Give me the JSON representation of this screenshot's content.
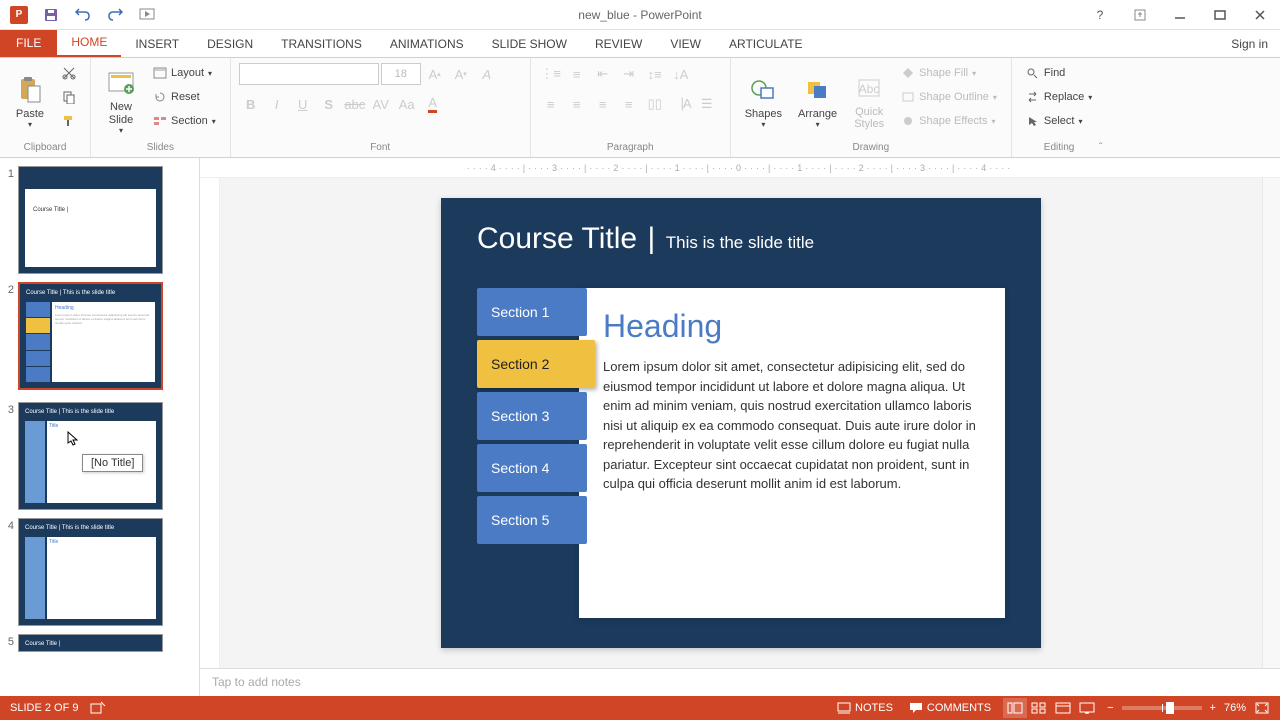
{
  "app": {
    "title": "new_blue - PowerPoint",
    "signin": "Sign in"
  },
  "tabs": {
    "file": "FILE",
    "home": "HOME",
    "insert": "INSERT",
    "design": "DESIGN",
    "transitions": "TRANSITIONS",
    "animations": "ANIMATIONS",
    "slideshow": "SLIDE SHOW",
    "review": "REVIEW",
    "view": "VIEW",
    "articulate": "ARTICULATE"
  },
  "ribbon": {
    "clipboard": {
      "label": "Clipboard",
      "paste": "Paste"
    },
    "slides": {
      "label": "Slides",
      "new_slide": "New\nSlide",
      "layout": "Layout",
      "reset": "Reset",
      "section": "Section"
    },
    "font": {
      "label": "Font",
      "size": "18"
    },
    "paragraph": {
      "label": "Paragraph"
    },
    "drawing": {
      "label": "Drawing",
      "shapes": "Shapes",
      "arrange": "Arrange",
      "quick_styles": "Quick\nStyles",
      "fill": "Shape Fill",
      "outline": "Shape Outline",
      "effects": "Shape Effects"
    },
    "editing": {
      "label": "Editing",
      "find": "Find",
      "replace": "Replace",
      "select": "Select"
    }
  },
  "thumbs": {
    "s1": "Course Title |",
    "s2": "Course Title | This is the slide title",
    "s3": "Course Title | This is the slide title",
    "s4": "Course Title | This is the slide title",
    "s5": "Course Title |",
    "tooltip": "[No Title]"
  },
  "slide": {
    "course_title": "Course Title",
    "subtitle": "This is the slide title",
    "sections": {
      "s1": "Section 1",
      "s2": "Section 2",
      "s3": "Section 3",
      "s4": "Section 4",
      "s5": "Section 5"
    },
    "heading": "Heading",
    "body": "Lorem ipsum dolor sit amet, consectetur adipisicing elit, sed do eiusmod tempor incididunt ut labore et dolore magna aliqua. Ut enim ad minim veniam, quis nostrud exercitation ullamco laboris nisi ut aliquip ex ea commodo consequat. Duis aute irure dolor in reprehenderit in voluptate velit esse cillum dolore eu fugiat nulla pariatur. Excepteur sint occaecat cupidatat non proident, sunt in culpa qui officia deserunt mollit anim id est laborum."
  },
  "notes": {
    "placeholder": "Tap to add notes"
  },
  "status": {
    "slide_count": "SLIDE 2 OF 9",
    "notes": "NOTES",
    "comments": "COMMENTS",
    "zoom": "76%"
  }
}
